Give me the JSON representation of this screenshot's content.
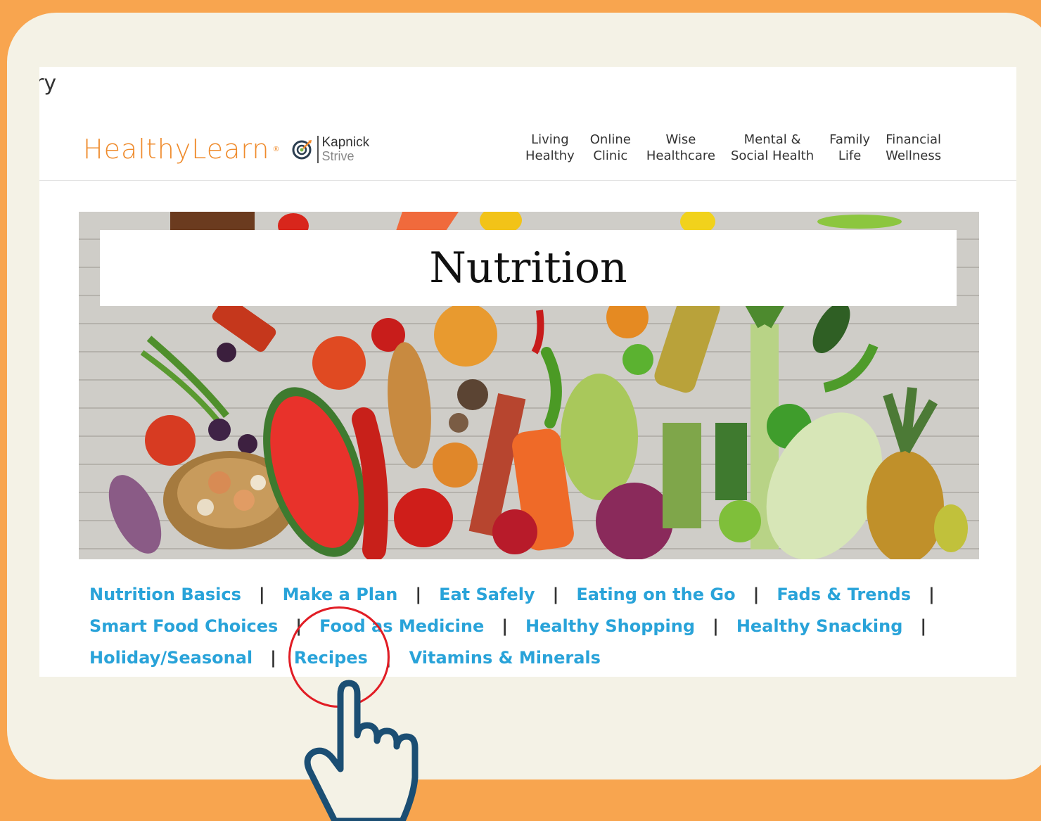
{
  "partial_text": "ry",
  "logo": {
    "brand": "HealthyLearn",
    "reg_mark": "®",
    "partner_name": "Kapnick",
    "partner_sub": "Strive"
  },
  "top_nav": [
    {
      "label": "Living\nHealthy"
    },
    {
      "label": "Online\nClinic"
    },
    {
      "label": "Wise\nHealthcare"
    },
    {
      "label": "Mental &\nSocial Health"
    },
    {
      "label": "Family\nLife"
    },
    {
      "label": "Financial\nWellness"
    }
  ],
  "hero": {
    "title": "Nutrition"
  },
  "sub_links": {
    "separator": "|",
    "items": [
      "Nutrition Basics",
      "Make a Plan",
      "Eat Safely",
      "Eating on the Go",
      "Fads & Trends",
      "Smart Food Choices",
      "Food as Medicine",
      "Healthy Shopping",
      "Healthy Snacking",
      "Holiday/Seasonal",
      "Recipes",
      "Vitamins & Minerals"
    ]
  },
  "colors": {
    "outer_bg": "#f8a54f",
    "card_bg": "#f4f2e6",
    "link": "#29a3d9",
    "brand_orange": "#ef8b2c",
    "highlight_circle": "#e11d25",
    "hand_outline": "#1b4e73"
  },
  "icons": {
    "partner_logo": "target-icon",
    "pointer": "pointing-hand-icon"
  }
}
